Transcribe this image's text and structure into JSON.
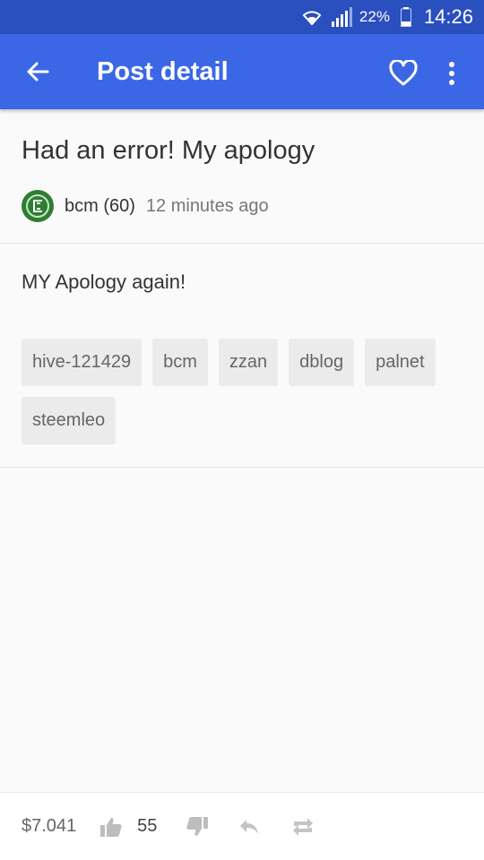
{
  "status_bar": {
    "battery_percent": "22%",
    "time": "14:26"
  },
  "app_bar": {
    "title": "Post detail",
    "icons": [
      "arrow-back-icon",
      "heart-outline-icon",
      "more-vert-icon"
    ]
  },
  "post": {
    "title": "Had an error! My apology",
    "author": "bcm (60)",
    "time_ago": "12 minutes ago",
    "body": "MY Apology again!",
    "tags": [
      "hive-121429",
      "bcm",
      "zzan",
      "dblog",
      "palnet",
      "steemleo"
    ]
  },
  "footer": {
    "payout": "$7.041",
    "votes": "55"
  },
  "colors": {
    "status_bar": "#2a4fbf",
    "app_bar": "#3b67e6",
    "avatar": "#2e7d32"
  }
}
